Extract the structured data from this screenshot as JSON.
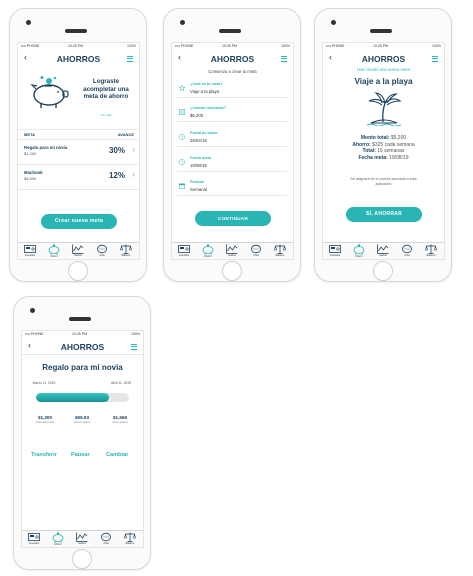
{
  "common": {
    "status_carrier": "•••• PHONE",
    "status_time": "10:25 PM",
    "status_battery": "100%",
    "nav_title": "AHORROS",
    "tabs": [
      "Inventario",
      "Ahorro",
      "Gastos",
      "Chat",
      "Balance"
    ]
  },
  "screen1": {
    "promo_title": "Lograste acompletar una meta de ahorro",
    "promo_link": "Ver más",
    "col_meta": "META",
    "col_avance": "AVANCE",
    "rows": [
      {
        "name": "Regalo para mi novia",
        "amount": "$1,200",
        "pct": "30%"
      },
      {
        "name": "Macbook",
        "amount": "$4,500",
        "pct": "12%"
      }
    ],
    "button": "Crear nueva meta"
  },
  "screen2": {
    "intro": "Comienza a crear tu meta",
    "fields": [
      {
        "label": "¿Cuál es tu meta?",
        "value": "Viaje a la playa",
        "icon": "star-icon"
      },
      {
        "label": "¿Cuánto necesitas?",
        "value": "$5,200",
        "icon": "money-icon"
      },
      {
        "label": "Fecha de inicio",
        "value": "25/04/19",
        "icon": "clock-icon"
      },
      {
        "label": "Fecha meta",
        "value": "19/08/19",
        "icon": "clock-icon"
      },
      {
        "label": "Periodo",
        "value": "Semanal",
        "icon": "calendar-icon"
      }
    ],
    "button": "CONTINUAR"
  },
  "screen3": {
    "created_note": "Has creado una nueva meta",
    "goal_title": "Viaje a la playa",
    "lines": [
      {
        "label": "Monto total:",
        "value": "$5,200"
      },
      {
        "label": "Ahorro:",
        "value": "$325 cada semana"
      },
      {
        "label": "Total:",
        "value": "16 semanas"
      },
      {
        "label": "Fecha meta:",
        "value": "19/08/19"
      }
    ],
    "note": "Se asignará de tu cuenta asociada a esta aplicación",
    "button": "SÍ, AHORRAR"
  },
  "screen4": {
    "goal_title": "Regalo para mi novia",
    "start_date": "Marzo 11, 2019",
    "end_date": "Abril 11, 2019",
    "progress": 0.78,
    "stats": [
      {
        "value": "$1,300",
        "label": "total ahorrado"
      },
      {
        "value": "$55.53",
        "label": "ahorro diario"
      },
      {
        "value": "$1,666",
        "label": "meta ahorro"
      }
    ],
    "actions": [
      "Transferir",
      "Pausar",
      "Cambiar"
    ]
  },
  "colors": {
    "teal": "#2ab5b5",
    "navy": "#1e4360"
  }
}
